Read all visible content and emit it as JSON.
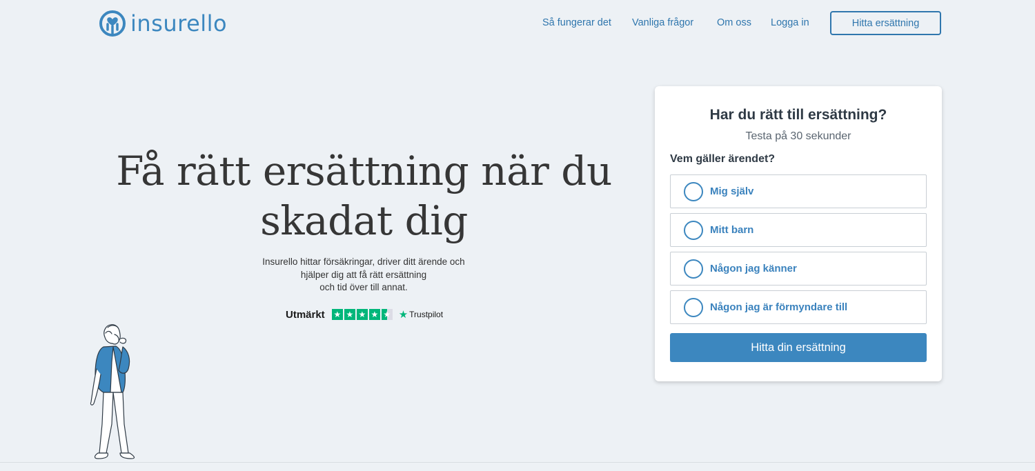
{
  "brand": {
    "name": "insurello",
    "accent": "#3c87bf"
  },
  "nav": {
    "items": [
      {
        "label": "Så fungerar det"
      },
      {
        "label": "Vanliga frågor"
      },
      {
        "label": "Om oss"
      },
      {
        "label": "Logga in"
      }
    ],
    "cta_label": "Hitta ersättning"
  },
  "hero": {
    "title": "Få rätt ersättning när du skadat dig",
    "subtitle_lines": [
      "Insurello hittar försäkringar, driver ditt ärende och",
      "hjälper dig att få rätt ersättning",
      "och tid över till annat."
    ],
    "trust": {
      "label": "Utmärkt",
      "rating_stars": 4.5,
      "max_stars": 5,
      "provider": "Trustpilot",
      "color": "#00b67a"
    }
  },
  "card": {
    "title": "Har du rätt till ersättning?",
    "subtitle": "Testa på 30 sekunder",
    "question": "Vem gäller ärendet?",
    "options": [
      {
        "label": "Mig själv"
      },
      {
        "label": "Mitt barn"
      },
      {
        "label": "Någon jag känner"
      },
      {
        "label": "Någon jag är förmyndare till"
      }
    ],
    "submit_label": "Hitta din ersättning"
  }
}
